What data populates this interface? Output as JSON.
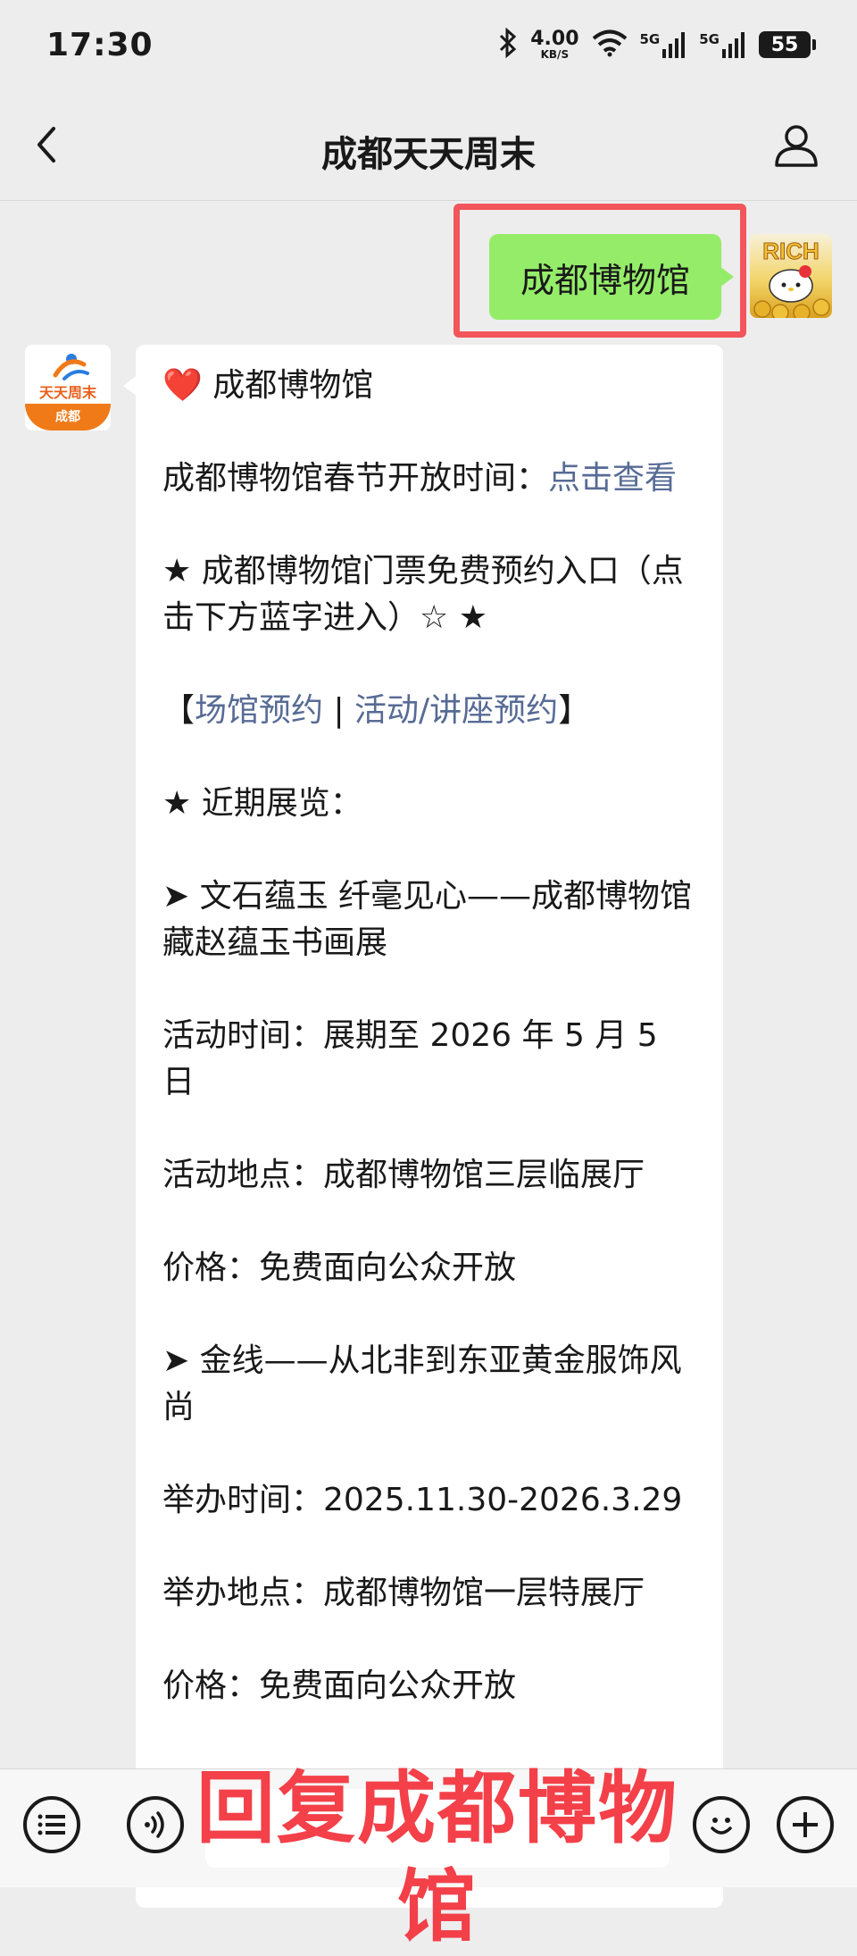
{
  "status_bar": {
    "time": "17:30",
    "net_speed_value": "4.00",
    "net_speed_unit": "KB/S",
    "signal1_label": "5G",
    "signal2_label": "5G",
    "battery": "55",
    "icons": [
      "bluetooth-icon",
      "wifi-icon",
      "signal-icon",
      "signal-icon",
      "battery-icon"
    ]
  },
  "nav": {
    "title": "成都天天周末",
    "back_icon": "chevron-left-icon",
    "profile_icon": "person-icon"
  },
  "chat": {
    "sent_message": "成都博物馆",
    "my_avatar_text": "RICH",
    "bot_avatar_top": "天天周末",
    "bot_avatar_bottom": "成都",
    "reply": {
      "heading_emoji": "❤️",
      "heading": "成都博物馆",
      "spring_hours_label": "成都博物馆春节开放时间：",
      "spring_hours_link": "点击查看",
      "ticket_entry": "★ 成都博物馆门票免费预约入口（点击下方蓝字进入）☆ ★",
      "bracket_open": "【",
      "venue_link": "场馆预约",
      "separator": " | ",
      "activity_link": "活动/讲座预约",
      "bracket_close": "】",
      "recent_label": "★ 近期展览：",
      "exhibitions": [
        {
          "title": "➤ 文石蕴玉 纤毫见心——成都博物馆藏赵蕴玉书画展",
          "time": "活动时间：展期至 2026 年 5 月 5 日",
          "place": "活动地点：成都博物馆三层临展厅",
          "price": "价格：免费面向公众开放"
        },
        {
          "title": "➤ 金线——从北非到东亚黄金服饰风尚",
          "time": "举办时间：2025.11.30-2026.3.29",
          "place": "举办地点：成都博物馆一层特展厅",
          "price": "价格：免费面向公众开放"
        }
      ]
    }
  },
  "bottom_bar": {
    "menu_icon": "menu-list-icon",
    "voice_icon": "voice-icon",
    "emoji_icon": "emoji-icon",
    "plus_icon": "plus-icon",
    "overlay_text": "回复成都博物馆"
  },
  "colors": {
    "sent_bubble": "#95ec69",
    "highlight": "#f2555b",
    "link": "#576b95",
    "overlay": "#f2303a"
  }
}
